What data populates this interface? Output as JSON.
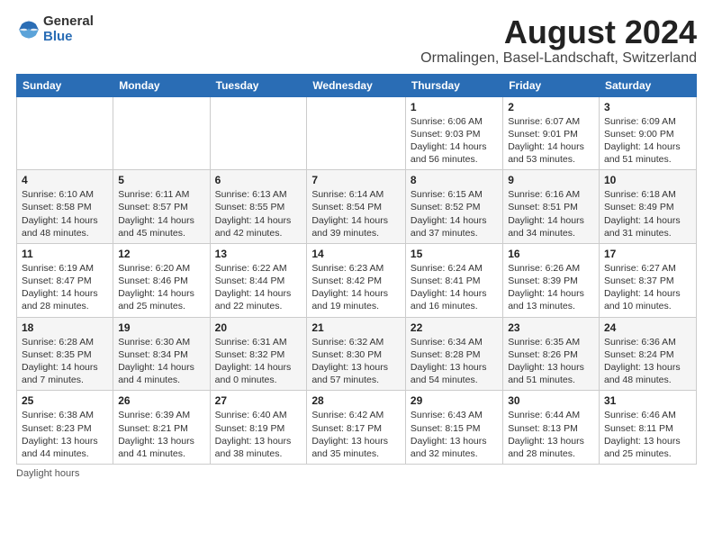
{
  "logo": {
    "general": "General",
    "blue": "Blue"
  },
  "title": "August 2024",
  "subtitle": "Ormalingen, Basel-Landschaft, Switzerland",
  "days_header": [
    "Sunday",
    "Monday",
    "Tuesday",
    "Wednesday",
    "Thursday",
    "Friday",
    "Saturday"
  ],
  "weeks": [
    [
      {
        "day": "",
        "info": ""
      },
      {
        "day": "",
        "info": ""
      },
      {
        "day": "",
        "info": ""
      },
      {
        "day": "",
        "info": ""
      },
      {
        "day": "1",
        "info": "Sunrise: 6:06 AM\nSunset: 9:03 PM\nDaylight: 14 hours and 56 minutes."
      },
      {
        "day": "2",
        "info": "Sunrise: 6:07 AM\nSunset: 9:01 PM\nDaylight: 14 hours and 53 minutes."
      },
      {
        "day": "3",
        "info": "Sunrise: 6:09 AM\nSunset: 9:00 PM\nDaylight: 14 hours and 51 minutes."
      }
    ],
    [
      {
        "day": "4",
        "info": "Sunrise: 6:10 AM\nSunset: 8:58 PM\nDaylight: 14 hours and 48 minutes."
      },
      {
        "day": "5",
        "info": "Sunrise: 6:11 AM\nSunset: 8:57 PM\nDaylight: 14 hours and 45 minutes."
      },
      {
        "day": "6",
        "info": "Sunrise: 6:13 AM\nSunset: 8:55 PM\nDaylight: 14 hours and 42 minutes."
      },
      {
        "day": "7",
        "info": "Sunrise: 6:14 AM\nSunset: 8:54 PM\nDaylight: 14 hours and 39 minutes."
      },
      {
        "day": "8",
        "info": "Sunrise: 6:15 AM\nSunset: 8:52 PM\nDaylight: 14 hours and 37 minutes."
      },
      {
        "day": "9",
        "info": "Sunrise: 6:16 AM\nSunset: 8:51 PM\nDaylight: 14 hours and 34 minutes."
      },
      {
        "day": "10",
        "info": "Sunrise: 6:18 AM\nSunset: 8:49 PM\nDaylight: 14 hours and 31 minutes."
      }
    ],
    [
      {
        "day": "11",
        "info": "Sunrise: 6:19 AM\nSunset: 8:47 PM\nDaylight: 14 hours and 28 minutes."
      },
      {
        "day": "12",
        "info": "Sunrise: 6:20 AM\nSunset: 8:46 PM\nDaylight: 14 hours and 25 minutes."
      },
      {
        "day": "13",
        "info": "Sunrise: 6:22 AM\nSunset: 8:44 PM\nDaylight: 14 hours and 22 minutes."
      },
      {
        "day": "14",
        "info": "Sunrise: 6:23 AM\nSunset: 8:42 PM\nDaylight: 14 hours and 19 minutes."
      },
      {
        "day": "15",
        "info": "Sunrise: 6:24 AM\nSunset: 8:41 PM\nDaylight: 14 hours and 16 minutes."
      },
      {
        "day": "16",
        "info": "Sunrise: 6:26 AM\nSunset: 8:39 PM\nDaylight: 14 hours and 13 minutes."
      },
      {
        "day": "17",
        "info": "Sunrise: 6:27 AM\nSunset: 8:37 PM\nDaylight: 14 hours and 10 minutes."
      }
    ],
    [
      {
        "day": "18",
        "info": "Sunrise: 6:28 AM\nSunset: 8:35 PM\nDaylight: 14 hours and 7 minutes."
      },
      {
        "day": "19",
        "info": "Sunrise: 6:30 AM\nSunset: 8:34 PM\nDaylight: 14 hours and 4 minutes."
      },
      {
        "day": "20",
        "info": "Sunrise: 6:31 AM\nSunset: 8:32 PM\nDaylight: 14 hours and 0 minutes."
      },
      {
        "day": "21",
        "info": "Sunrise: 6:32 AM\nSunset: 8:30 PM\nDaylight: 13 hours and 57 minutes."
      },
      {
        "day": "22",
        "info": "Sunrise: 6:34 AM\nSunset: 8:28 PM\nDaylight: 13 hours and 54 minutes."
      },
      {
        "day": "23",
        "info": "Sunrise: 6:35 AM\nSunset: 8:26 PM\nDaylight: 13 hours and 51 minutes."
      },
      {
        "day": "24",
        "info": "Sunrise: 6:36 AM\nSunset: 8:24 PM\nDaylight: 13 hours and 48 minutes."
      }
    ],
    [
      {
        "day": "25",
        "info": "Sunrise: 6:38 AM\nSunset: 8:23 PM\nDaylight: 13 hours and 44 minutes."
      },
      {
        "day": "26",
        "info": "Sunrise: 6:39 AM\nSunset: 8:21 PM\nDaylight: 13 hours and 41 minutes."
      },
      {
        "day": "27",
        "info": "Sunrise: 6:40 AM\nSunset: 8:19 PM\nDaylight: 13 hours and 38 minutes."
      },
      {
        "day": "28",
        "info": "Sunrise: 6:42 AM\nSunset: 8:17 PM\nDaylight: 13 hours and 35 minutes."
      },
      {
        "day": "29",
        "info": "Sunrise: 6:43 AM\nSunset: 8:15 PM\nDaylight: 13 hours and 32 minutes."
      },
      {
        "day": "30",
        "info": "Sunrise: 6:44 AM\nSunset: 8:13 PM\nDaylight: 13 hours and 28 minutes."
      },
      {
        "day": "31",
        "info": "Sunrise: 6:46 AM\nSunset: 8:11 PM\nDaylight: 13 hours and 25 minutes."
      }
    ]
  ],
  "footer": "Daylight hours"
}
